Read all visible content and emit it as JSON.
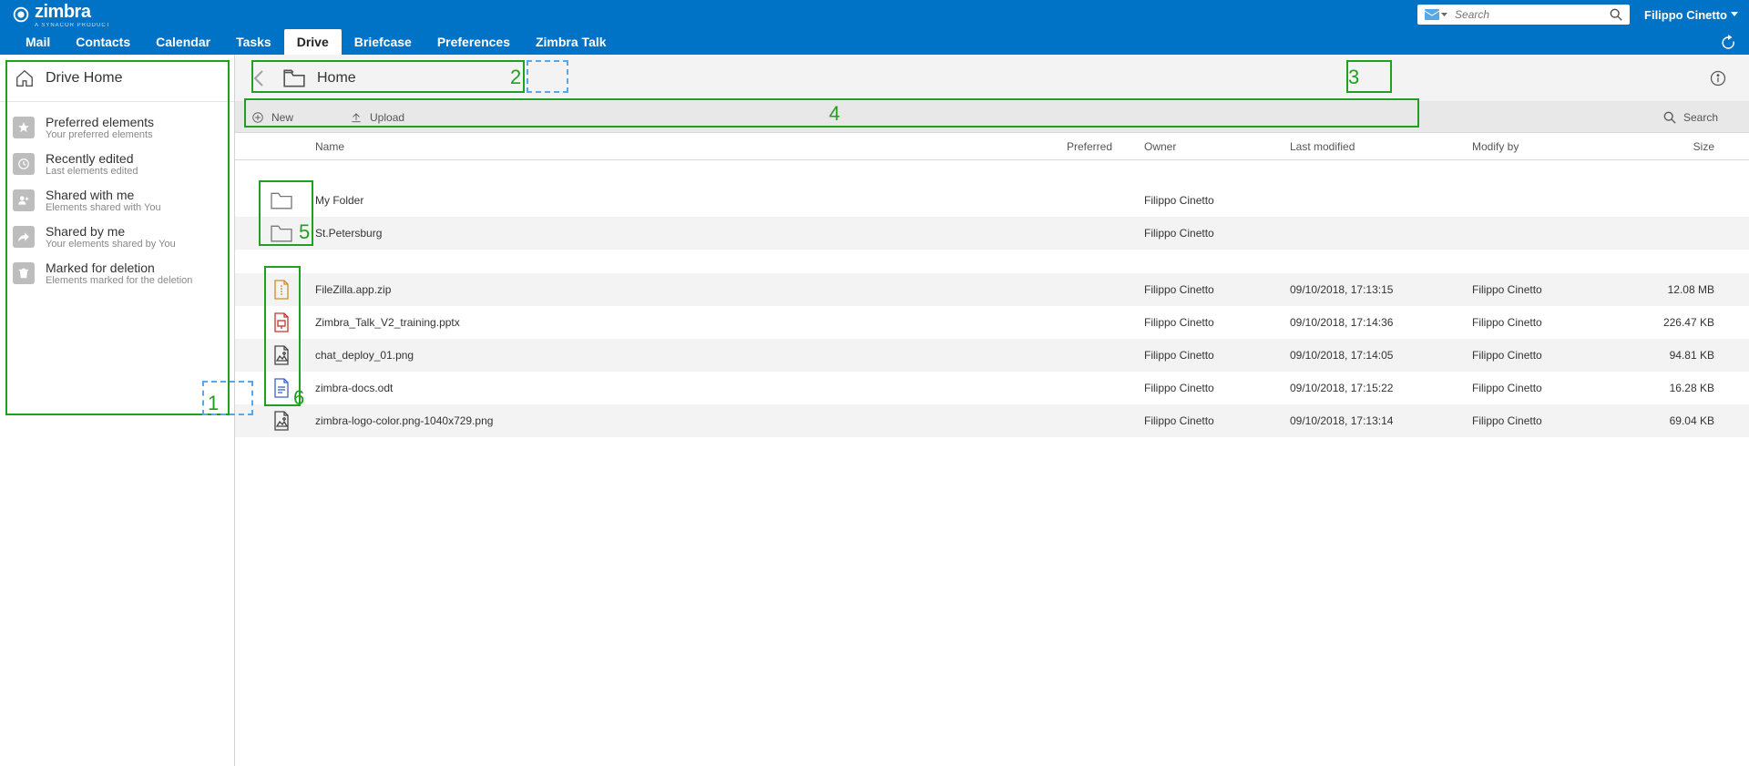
{
  "header": {
    "logo_text": "zimbra",
    "logo_sub": "A SYNACOR PRODUCT",
    "search_placeholder": "Search",
    "user_name": "Filippo Cinetto"
  },
  "nav": {
    "tabs": [
      "Mail",
      "Contacts",
      "Calendar",
      "Tasks",
      "Drive",
      "Briefcase",
      "Preferences",
      "Zimbra Talk"
    ],
    "active": "Drive"
  },
  "sidebar": {
    "home_label": "Drive Home",
    "items": [
      {
        "title": "Preferred elements",
        "sub": "Your preferred elements"
      },
      {
        "title": "Recently edited",
        "sub": "Last elements edited"
      },
      {
        "title": "Shared with me",
        "sub": "Elements shared with You"
      },
      {
        "title": "Shared by me",
        "sub": "Your elements shared by You"
      },
      {
        "title": "Marked for deletion",
        "sub": "Elements marked for the deletion"
      }
    ]
  },
  "breadcrumb": {
    "label": "Home"
  },
  "actionbar": {
    "new": "New",
    "upload": "Upload",
    "search": "Search"
  },
  "table": {
    "headers": {
      "name": "Name",
      "preferred": "Preferred",
      "owner": "Owner",
      "last_modified": "Last modified",
      "modify_by": "Modify by",
      "size": "Size"
    },
    "folders": [
      {
        "name": "My Folder",
        "owner": "Filippo Cinetto"
      },
      {
        "name": "St.Petersburg",
        "owner": "Filippo Cinetto"
      }
    ],
    "files": [
      {
        "name": "FileZilla.app.zip",
        "owner": "Filippo Cinetto",
        "lm": "09/10/2018, 17:13:15",
        "mb": "Filippo Cinetto",
        "size": "12.08 MB",
        "ico": "zip"
      },
      {
        "name": "Zimbra_Talk_V2_training.pptx",
        "owner": "Filippo Cinetto",
        "lm": "09/10/2018, 17:14:36",
        "mb": "Filippo Cinetto",
        "size": "226.47 KB",
        "ico": "ppt"
      },
      {
        "name": "chat_deploy_01.png",
        "owner": "Filippo Cinetto",
        "lm": "09/10/2018, 17:14:05",
        "mb": "Filippo Cinetto",
        "size": "94.81 KB",
        "ico": "img"
      },
      {
        "name": "zimbra-docs.odt",
        "owner": "Filippo Cinetto",
        "lm": "09/10/2018, 17:15:22",
        "mb": "Filippo Cinetto",
        "size": "16.28 KB",
        "ico": "doc"
      },
      {
        "name": "zimbra-logo-color.png-1040x729.png",
        "owner": "Filippo Cinetto",
        "lm": "09/10/2018, 17:13:14",
        "mb": "Filippo Cinetto",
        "size": "69.04 KB",
        "ico": "img"
      }
    ]
  },
  "annotations": [
    "1",
    "2",
    "3",
    "4",
    "5",
    "6"
  ]
}
